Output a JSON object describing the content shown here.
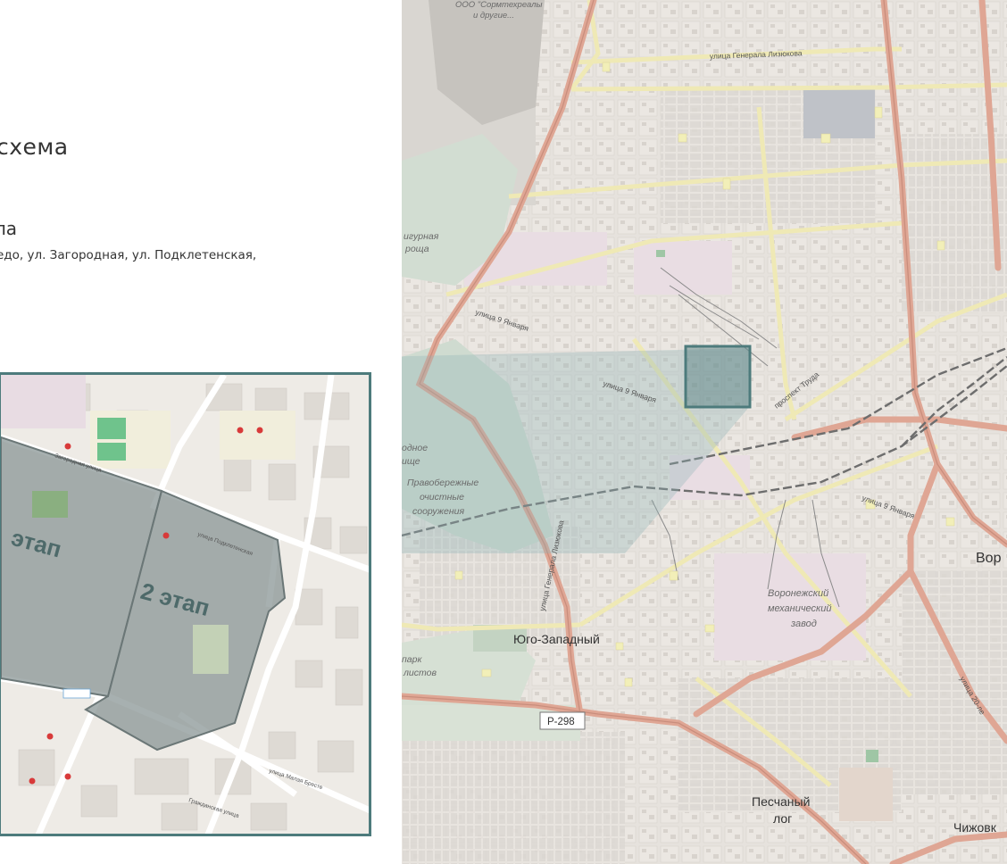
{
  "slide": {
    "heading": "схема",
    "subheading": "ла",
    "address": "едо, ул. Загородная, ул. Подклетенская,"
  },
  "inset_map": {
    "stage_1_label": "этап",
    "stage_2_label": "2 этап",
    "stage_fill_color": "#8a9696",
    "frame_color": "#4d7b7c",
    "street_labels": [
      "Загородная улица",
      "улица Подклетенская",
      "улица Малая Бресте",
      "Гражданская улица"
    ]
  },
  "city_map": {
    "labels": {
      "top_label_1": "ООО \"Сормтехреалы",
      "top_label_2": "и другие...",
      "street_lizyukova": "улица Генерала Лизюкова",
      "grove_1": "игурная",
      "grove_2": "роща",
      "street_9_january_a": "улица 9 Января",
      "street_9_january_b": "улица 9 Января",
      "street_9_january_c": "улица 9 Января",
      "prospekt_truda": "проспект Труда",
      "water_1": "одное",
      "water_2": "ище",
      "treatment_1": "Правобережные",
      "treatment_2": "очистные",
      "treatment_3": "сооружения",
      "street_gen_lizyukova_sw": "улица Генерала Лизюкова",
      "factory_1": "Воронежский",
      "factory_2": "механический",
      "factory_3": "завод",
      "city_partial": "Вор",
      "district_yugo_zapadny": "Юго-Западный",
      "park_1": "парк",
      "park_2": "листов",
      "road_r298": "Р-298",
      "district_peschany_1": "Песчаный",
      "district_peschany_2": "лог",
      "district_chizhovka": "Чижовк",
      "street_20_let": "улица 20-ле"
    },
    "highlight_color": "#4d7b7c",
    "main_road_color": "#e0a895",
    "secondary_road_color": "#f2eec2",
    "railway_color": "#7b7b7b"
  }
}
